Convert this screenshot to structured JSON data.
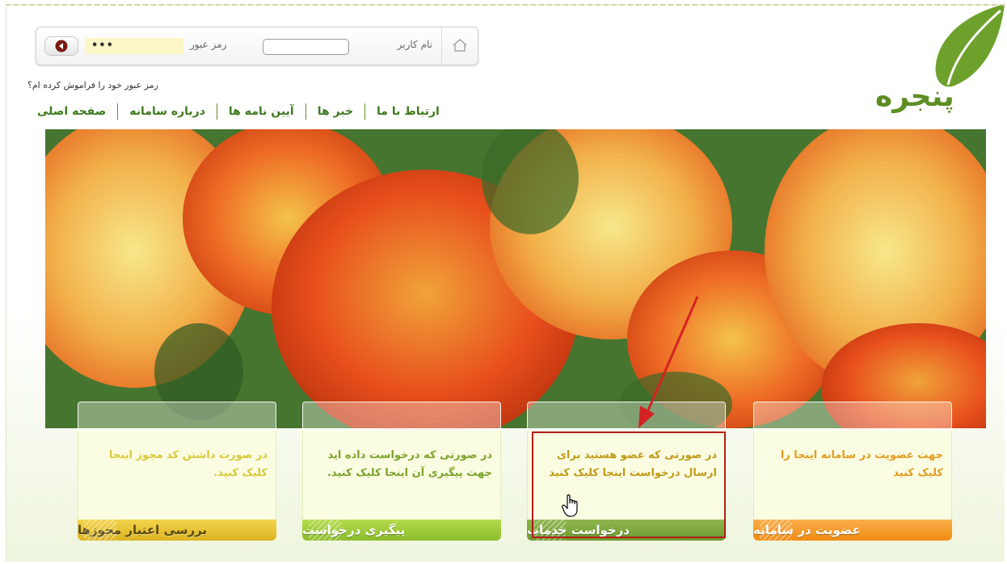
{
  "login": {
    "username_label": "نام کاربر",
    "username_value": "",
    "password_label": "رمز عبور",
    "password_value": "•••",
    "forgot_link": "رمز عبور خود را فراموش کرده ام؟"
  },
  "logo": {
    "text": "پنجره"
  },
  "nav": {
    "items": [
      "صفحه اصلی",
      "درباره سامانه",
      "آیین نامه ها",
      "خبر ها",
      "ارتباط با ما"
    ]
  },
  "cards": [
    {
      "title": "عضویت در سامانه",
      "desc": "جهت عضویت در سامانه اینجا را کلیک کنید"
    },
    {
      "title": "درخواست خدمات",
      "desc": "در صورتی که عضو هستید برای ارسال درخواست اینجا کلیک کنید"
    },
    {
      "title": "پیگیری درخواست",
      "desc": "در صورتی که درخواست داده اید جهت پیگیری آن اینجا کلیک کنید."
    },
    {
      "title": "بررسی اعتبار مجوزها",
      "desc": "در صورت داشتن کد مجوز اینجا کلیک کنید."
    }
  ],
  "colors": {
    "brand_green": "#5d8e24",
    "highlight_red": "#b31b1b"
  }
}
